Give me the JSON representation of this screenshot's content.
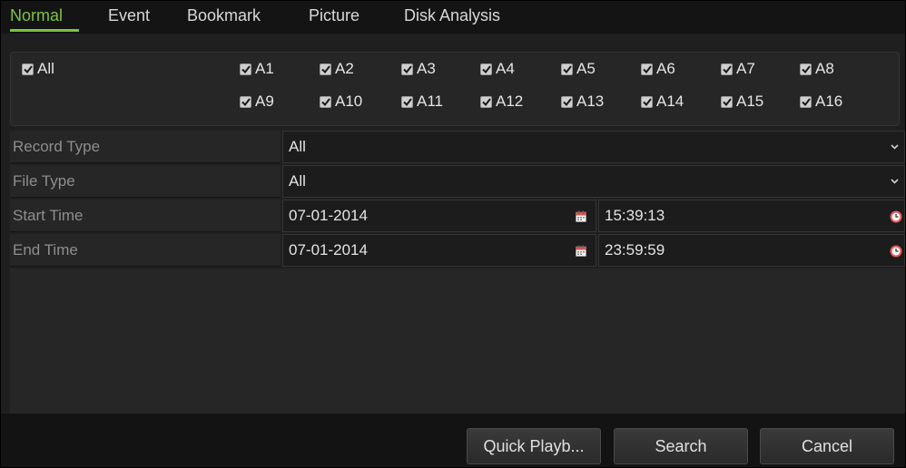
{
  "tabs": [
    {
      "label": "Normal"
    },
    {
      "label": "Event"
    },
    {
      "label": "Bookmark"
    },
    {
      "label": "Picture"
    },
    {
      "label": "Disk Analysis"
    }
  ],
  "active_tab": "Normal",
  "channels": {
    "all_label": "All",
    "all_checked": true,
    "items": [
      {
        "label": "A1",
        "checked": true
      },
      {
        "label": "A2",
        "checked": true
      },
      {
        "label": "A3",
        "checked": true
      },
      {
        "label": "A4",
        "checked": true
      },
      {
        "label": "A5",
        "checked": true
      },
      {
        "label": "A6",
        "checked": true
      },
      {
        "label": "A7",
        "checked": true
      },
      {
        "label": "A8",
        "checked": true
      },
      {
        "label": "A9",
        "checked": true
      },
      {
        "label": "A10",
        "checked": true
      },
      {
        "label": "A11",
        "checked": true
      },
      {
        "label": "A12",
        "checked": true
      },
      {
        "label": "A13",
        "checked": true
      },
      {
        "label": "A14",
        "checked": true
      },
      {
        "label": "A15",
        "checked": true
      },
      {
        "label": "A16",
        "checked": true
      }
    ]
  },
  "form": {
    "record_type": {
      "label": "Record Type",
      "value": "All"
    },
    "file_type": {
      "label": "File Type",
      "value": "All"
    },
    "start_time": {
      "label": "Start Time",
      "date": "07-01-2014",
      "time": "15:39:13"
    },
    "end_time": {
      "label": "End Time",
      "date": "07-01-2014",
      "time": "23:59:59"
    }
  },
  "buttons": {
    "quick_playback": "Quick Playb...",
    "search": "Search",
    "cancel": "Cancel"
  },
  "icons": {
    "dropdown": "chevron-down-icon",
    "calendar": "calendar-icon",
    "clock": "clock-icon",
    "checkbox": "checkmark-icon"
  },
  "colors": {
    "accent": "#7fc241",
    "background": "#1f1f1f",
    "clock": "#e85a5a",
    "calendar": "#d9534f"
  }
}
